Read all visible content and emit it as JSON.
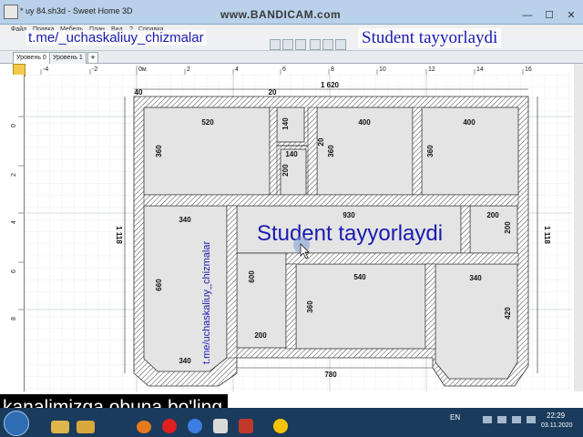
{
  "window": {
    "title": "* uy 84.sh3d - Sweet Home 3D",
    "recorder": "www.BANDICAM.com",
    "min": "—",
    "max": "☐",
    "close": "✕"
  },
  "menu": [
    "Файл",
    "Правка",
    "Мебель",
    "План",
    "Вид",
    "?",
    "Справка"
  ],
  "tabs": [
    "Уровень 0",
    "Уровень 1"
  ],
  "tab_add": "+",
  "watermarks": {
    "channel": "t.me/_uchaskaliuy_chizmalar",
    "student_top": "Student tayyorlaydi",
    "student_plan": "Student tayyorlaydi",
    "channel_vertical": "t.me/uchaskaliuy_chizmalar"
  },
  "rulers": {
    "h_ticks": [
      "-4",
      "-2",
      "0м",
      "2",
      "4",
      "6",
      "8",
      "10",
      "12",
      "14",
      "16"
    ],
    "v_ticks": [
      "0",
      "2",
      "4",
      "6",
      "8"
    ]
  },
  "plan": {
    "dims": {
      "top_wall": "1 620",
      "left_side": "1 118",
      "right_side": "1 118",
      "corner_40": "40",
      "corner_20": "20",
      "bottom_entry": "780",
      "room_a_w": "520",
      "room_a_h": "360",
      "closet_w": "140",
      "closet_h1": "140",
      "closet_w2": "140",
      "closet_h2": "200",
      "bath_wall": "20",
      "room_b_w": "400",
      "room_b_h": "360",
      "room_c_w": "400",
      "room_c_h": "360",
      "hall_w": "930",
      "room_d_w": "340",
      "room_d_h": "660",
      "room_d_bottom": "340",
      "corr_h": "600",
      "corr_w": "200",
      "small_w": "200",
      "small_h": "200",
      "room_e_w": "540",
      "room_e_h": "360",
      "room_f_w": "340",
      "room_f_h": "420"
    }
  },
  "subtitle": "kanalimizga obuna bo'ling",
  "taskbar": {
    "lang": "EN",
    "time": "22:29",
    "date": "03.11.2020",
    "apps": [
      "explorer",
      "folder",
      "media-player",
      "yandex",
      "browser",
      "sweethome3d",
      "bandicam",
      "yandex-browser"
    ]
  },
  "colors": {
    "wall_hatch": "#444444",
    "floor": "#e4e4e4",
    "grid": "#c9d3dc",
    "watermark": "#1a1ab0"
  }
}
